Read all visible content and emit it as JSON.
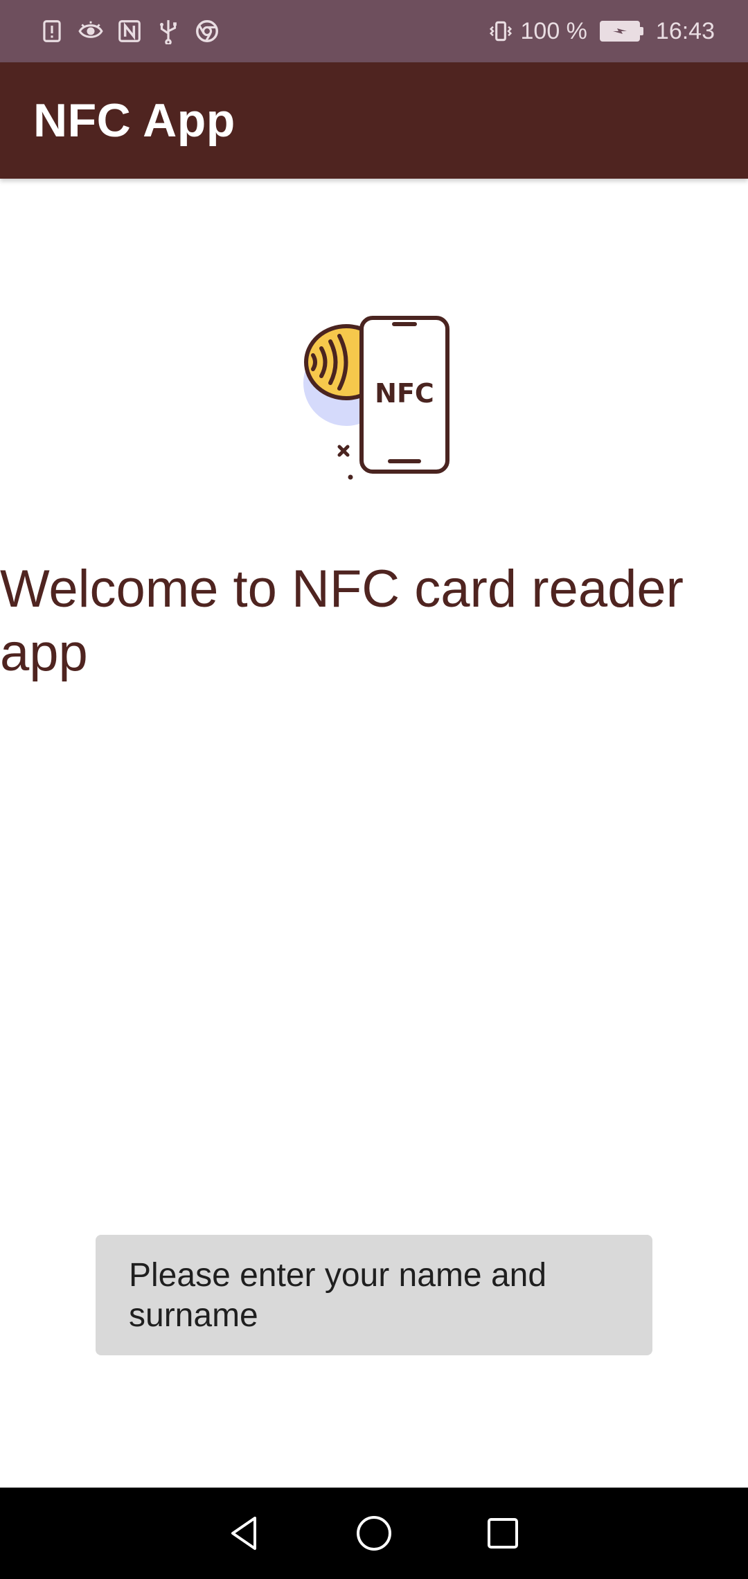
{
  "status_bar": {
    "left_icons": [
      "alert-icon",
      "eye-icon",
      "nfc-icon",
      "usb-icon",
      "chrome-icon"
    ],
    "vibrate_icon": "vibrate-icon",
    "battery_percent": "100 %",
    "battery_level": 1.0,
    "time": "16:43"
  },
  "app_bar": {
    "title": "NFC App"
  },
  "illustration": {
    "label": "NFC",
    "colors": {
      "outline": "#4a2420",
      "card": "#f6c84c",
      "circle": "#d5dafb"
    }
  },
  "main": {
    "welcome_text": "Welcome to NFC card reader app",
    "name_field": {
      "placeholder": "Please enter your name and surname"
    }
  },
  "nav_bar": {
    "buttons": [
      "back-icon",
      "home-icon",
      "recents-icon"
    ]
  },
  "colors": {
    "status_bar": "#6e4f5d",
    "app_bar": "#4f2420",
    "accent_text": "#4f2420",
    "field_bg": "#d9d9d9"
  }
}
